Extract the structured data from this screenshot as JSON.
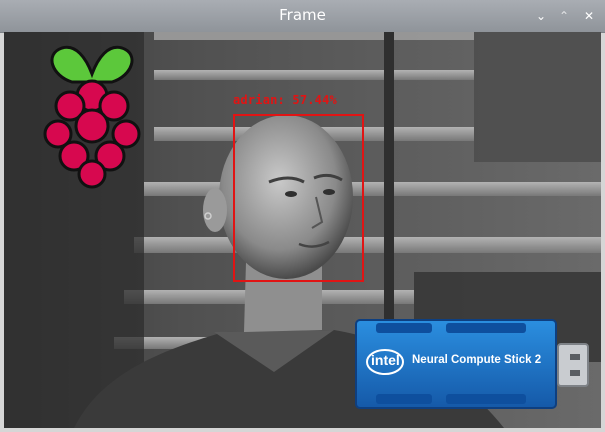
{
  "window": {
    "title": "Frame",
    "controls": {
      "minimize": "⌄",
      "maximize": "⌃",
      "close": "✕"
    }
  },
  "frame": {
    "detection": {
      "label": "adrian: 57.44%"
    },
    "overlay": {
      "logo": "raspberry-pi-logo",
      "device": {
        "brand": "intel",
        "name": "Neural Compute Stick 2"
      }
    }
  },
  "colors": {
    "detection": "#e11414",
    "device_blue": "#1e73c8",
    "titlebar": "#9ca0a6"
  }
}
